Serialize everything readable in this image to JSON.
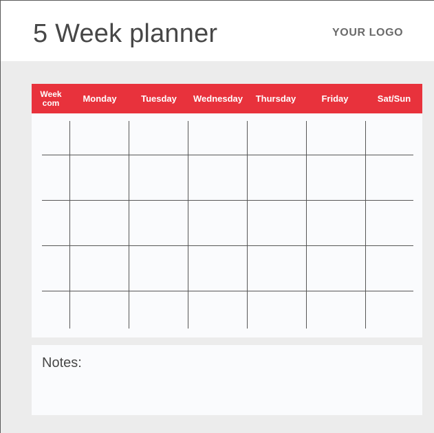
{
  "header": {
    "title": "5 Week planner",
    "logo": "YOUR LOGO"
  },
  "calendar": {
    "columns": [
      {
        "label": "Week com"
      },
      {
        "label": "Monday"
      },
      {
        "label": "Tuesday"
      },
      {
        "label": "Wednesday"
      },
      {
        "label": "Thursday"
      },
      {
        "label": "Friday"
      },
      {
        "label": "Sat/Sun"
      }
    ],
    "week_col_line1": "Week",
    "week_col_line2": "com",
    "rows": 5
  },
  "notes": {
    "label": "Notes:"
  },
  "colors": {
    "accent": "#e8323c",
    "background": "#ececec",
    "panel": "#fafbfd",
    "text": "#474747"
  }
}
